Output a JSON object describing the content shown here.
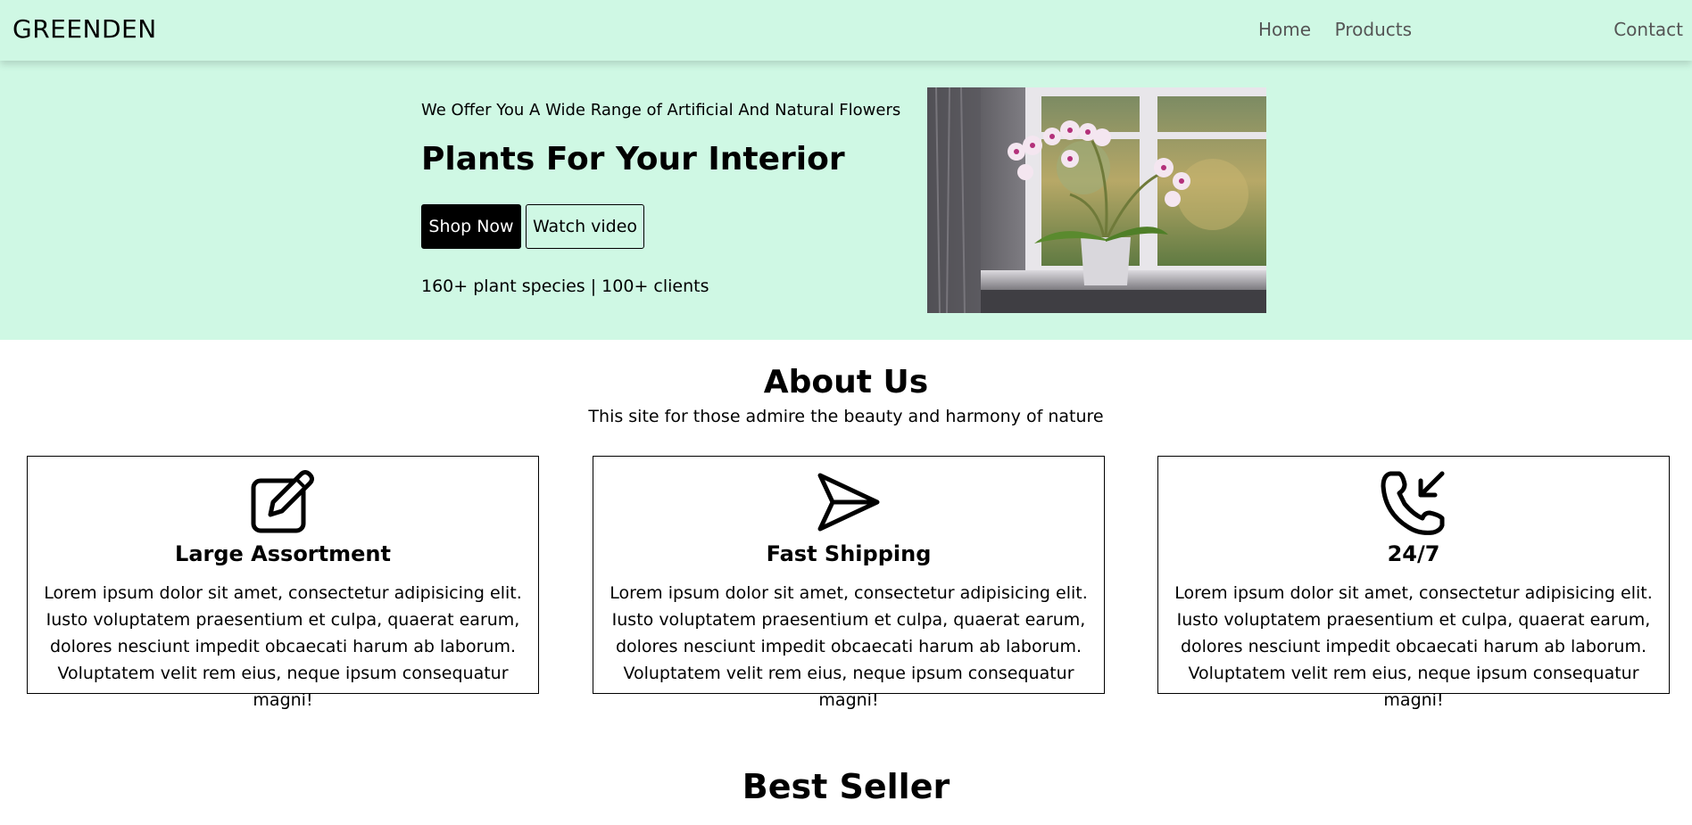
{
  "navbar": {
    "brand": "GREENDEN",
    "links": [
      "Home",
      "Products",
      "Contact"
    ]
  },
  "hero": {
    "subtitle": "We Offer You A Wide Range of Artificial And Natural Flowers",
    "title": "Plants For Your Interior",
    "shop_button": "Shop Now",
    "watch_button": "Watch video",
    "stats": "160+ plant species | 100+ clients",
    "image": "orchid-on-windowsill"
  },
  "about": {
    "title": "About Us",
    "subtitle": "This site for those admire the beauty and harmony of nature",
    "cards": [
      {
        "icon": "edit-icon",
        "title": "Large Assortment",
        "text": "Lorem ipsum dolor sit amet, consectetur adipisicing elit. Iusto voluptatem praesentium et culpa, quaerat earum, dolores nesciunt impedit obcaecati harum ab laborum. Voluptatem velit rem eius, neque ipsum consequatur magni!"
      },
      {
        "icon": "send-icon",
        "title": "Fast Shipping",
        "text": "Lorem ipsum dolor sit amet, consectetur adipisicing elit. Iusto voluptatem praesentium et culpa, quaerat earum, dolores nesciunt impedit obcaecati harum ab laborum. Voluptatem velit rem eius, neque ipsum consequatur magni!"
      },
      {
        "icon": "phone-incoming-icon",
        "title": "24/7",
        "text": "Lorem ipsum dolor sit amet, consectetur adipisicing elit. Iusto voluptatem praesentium et culpa, quaerat earum, dolores nesciunt impedit obcaecati harum ab laborum. Voluptatem velit rem eius, neque ipsum consequatur magni!"
      }
    ]
  },
  "best_seller": {
    "title": "Best Seller"
  },
  "colors": {
    "mint": "#cff8e4",
    "black": "#000000",
    "nav_link": "#555555"
  }
}
